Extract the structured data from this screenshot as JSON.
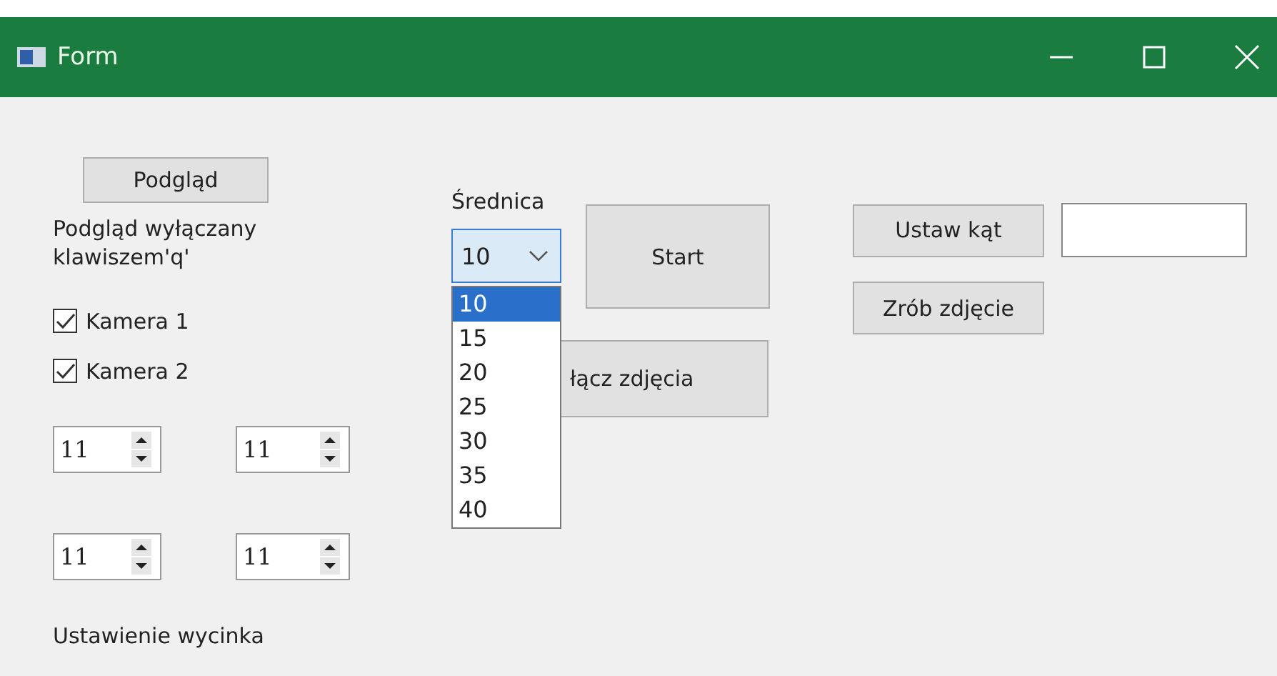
{
  "window": {
    "title": "Form"
  },
  "preview_button": "Podgląd",
  "preview_note": "Podgląd wyłączany\nklawiszem'q'",
  "cameras": [
    {
      "label": "Kamera 1",
      "checked": true
    },
    {
      "label": "Kamera 2",
      "checked": true
    }
  ],
  "spinboxes": [
    {
      "value": "11"
    },
    {
      "value": "11"
    },
    {
      "value": "11"
    },
    {
      "value": "11"
    }
  ],
  "crop_caption": "Ustawienie wycinka",
  "diameter": {
    "label": "Średnica",
    "value": "10",
    "expanded": true,
    "options": [
      {
        "label": "10",
        "selected": true
      },
      {
        "label": "15",
        "selected": false
      },
      {
        "label": "20",
        "selected": false
      },
      {
        "label": "25",
        "selected": false
      },
      {
        "label": "30",
        "selected": false
      },
      {
        "label": "35",
        "selected": false
      },
      {
        "label": "40",
        "selected": false
      }
    ]
  },
  "start_button": "Start",
  "merge_button": "łącz zdjęcia",
  "angle_button": "Ustaw kąt",
  "photo_button": "Zrób zdjęcie"
}
